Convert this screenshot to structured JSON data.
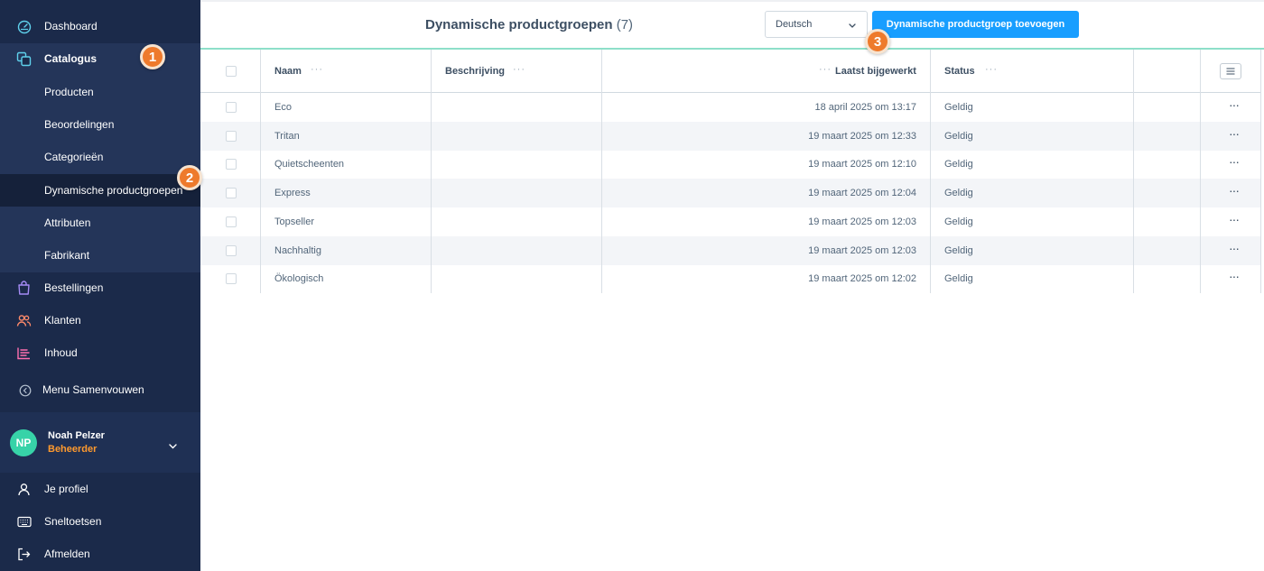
{
  "sidebar": {
    "dashboard": "Dashboard",
    "catalogus": "Catalogus",
    "sub": {
      "producten": "Producten",
      "beoordelingen": "Beoordelingen",
      "categorieen": "Categorieën",
      "dynamisch": "Dynamische productgroepen",
      "attributen": "Attributen",
      "fabrikant": "Fabrikant"
    },
    "bestellingen": "Bestellingen",
    "klanten": "Klanten",
    "inhoud": "Inhoud",
    "collapse": "Menu Samenvouwen",
    "user": {
      "initials": "NP",
      "name": "Noah Pelzer",
      "role": "Beheerder"
    },
    "profile": "Je profiel",
    "shortcuts": "Sneltoetsen",
    "logout": "Afmelden"
  },
  "badges": [
    "1",
    "2",
    "3"
  ],
  "header": {
    "title": "Dynamische productgroepen",
    "count": "(7)",
    "language": "Deutsch",
    "add_button": "Dynamische productgroep toevoegen"
  },
  "table": {
    "columns": {
      "name": "Naam",
      "description": "Beschrijving",
      "updated": "Laatst bijgewerkt",
      "status": "Status"
    },
    "rows": [
      {
        "name": "Eco",
        "description": "",
        "updated": "18 april 2025 om 13:17",
        "status": "Geldig"
      },
      {
        "name": "Tritan",
        "description": "",
        "updated": "19 maart 2025 om 12:33",
        "status": "Geldig"
      },
      {
        "name": "Quietscheenten",
        "description": "",
        "updated": "19 maart 2025 om 12:10",
        "status": "Geldig"
      },
      {
        "name": "Express",
        "description": "",
        "updated": "19 maart 2025 om 12:04",
        "status": "Geldig"
      },
      {
        "name": "Topseller",
        "description": "",
        "updated": "19 maart 2025 om 12:03",
        "status": "Geldig"
      },
      {
        "name": "Nachhaltig",
        "description": "",
        "updated": "19 maart 2025 om 12:03",
        "status": "Geldig"
      },
      {
        "name": "Ökologisch",
        "description": "",
        "updated": "19 maart 2025 om 12:02",
        "status": "Geldig"
      }
    ]
  },
  "colors": {
    "sidebar": "#1b2a4a",
    "submenu": "#243559",
    "active": "#15213a",
    "primary": "#189eff",
    "badge": "#ee7a2c",
    "avatar": "#37d3a8",
    "role": "#ff9a2e"
  }
}
